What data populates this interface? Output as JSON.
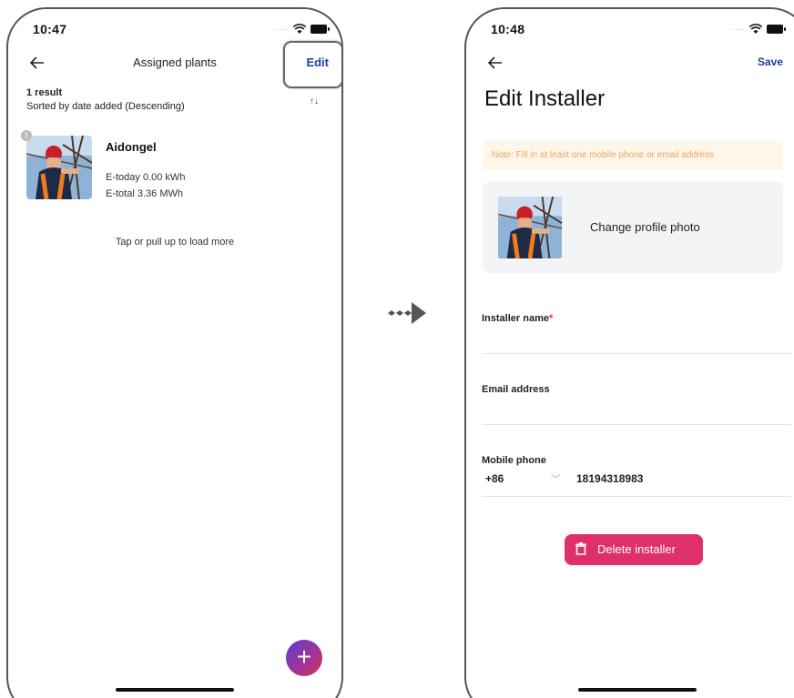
{
  "left_screen": {
    "status_time": "10:47",
    "nav_title": "Assigned plants",
    "edit_label": "Edit",
    "result_count": "1 result",
    "sort_text": "Sorted by date added (Descending)",
    "sort_icon": "↑↓",
    "plant": {
      "name": "Aidongel",
      "e_today": "E-today 0.00 kWh",
      "e_total": "E-total 3.36 MWh",
      "badge": "!"
    },
    "load_more": "Tap or pull up to load more",
    "fab_label": "+"
  },
  "right_screen": {
    "status_time": "10:48",
    "save_label": "Save",
    "title": "Edit Installer",
    "note": "Note: Fill in at least one mobile phone or email address",
    "change_photo": "Change profile photo",
    "installer_name_label": "Installer name",
    "required_mark": "*",
    "email_label": "Email address",
    "mobile_label": "Mobile phone",
    "country_code": "+86",
    "phone_number": "18194318983",
    "delete_label": "Delete installer"
  },
  "colors": {
    "accent_blue": "#1e3fa8",
    "delete_pink": "#e0306a",
    "note_text": "#f2a35a",
    "note_bg": "#fff6ea"
  },
  "icons": [
    "back-arrow-icon",
    "wifi-icon",
    "battery-icon",
    "sort-icon",
    "warning-icon",
    "add-icon",
    "trash-icon",
    "chevron-down-icon",
    "transition-arrow-icon"
  ]
}
